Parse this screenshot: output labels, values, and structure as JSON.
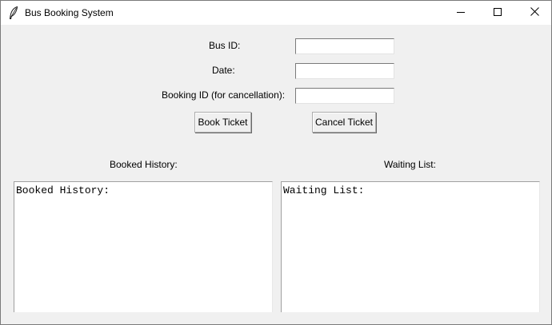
{
  "window": {
    "title": "Bus Booking System",
    "app_icon": "feather-icon",
    "controls": [
      "minimize-icon",
      "maximize-icon",
      "close-icon"
    ]
  },
  "form": {
    "bus_id": {
      "label": "Bus ID:",
      "value": ""
    },
    "date": {
      "label": "Date:",
      "value": ""
    },
    "booking_id": {
      "label": "Booking ID (for cancellation):",
      "value": ""
    }
  },
  "buttons": {
    "book_label": "Book Ticket",
    "cancel_label": "Cancel Ticket"
  },
  "history": {
    "heading": "Booked History:",
    "content": "Booked History:"
  },
  "waiting": {
    "heading": "Waiting List:",
    "content": "Waiting List:"
  }
}
